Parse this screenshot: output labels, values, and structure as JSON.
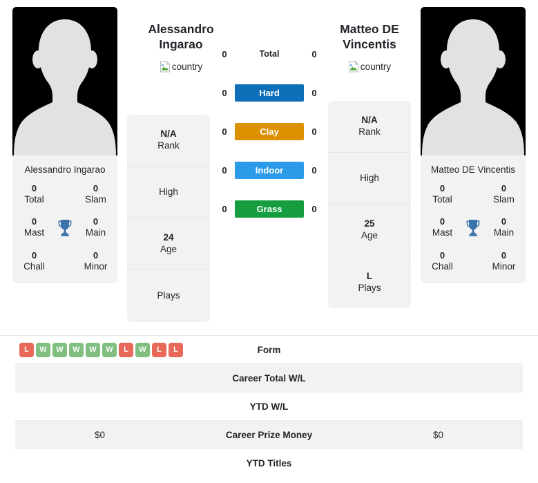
{
  "players": {
    "left": {
      "name": "Alessandro Ingarao",
      "display_name_line1": "Alessandro",
      "display_name_line2": "Ingarao",
      "country_alt": "country",
      "avatar_name": "player-avatar-placeholder",
      "titles": {
        "total_value": "0",
        "total_label": "Total",
        "slam_value": "0",
        "slam_label": "Slam",
        "mast_value": "0",
        "mast_label": "Mast",
        "main_value": "0",
        "main_label": "Main",
        "chall_value": "0",
        "chall_label": "Chall",
        "minor_value": "0",
        "minor_label": "Minor"
      },
      "info": {
        "rank_value": "N/A",
        "rank_label": "Rank",
        "high_value": "",
        "high_label": "High",
        "age_value": "24",
        "age_label": "Age",
        "plays_value": "",
        "plays_label": "Plays"
      },
      "surface_values": {
        "total": "0",
        "hard": "0",
        "clay": "0",
        "indoor": "0",
        "grass": "0"
      },
      "table_values": {
        "form": [
          "L",
          "W",
          "W",
          "W",
          "W",
          "W",
          "L",
          "W",
          "L",
          "L"
        ],
        "career_total_wl": "",
        "ytd_wl": "",
        "career_prize_money": "$0",
        "ytd_titles": ""
      }
    },
    "right": {
      "name": "Matteo DE Vincentis",
      "display_name_line1": "Matteo DE",
      "display_name_line2": "Vincentis",
      "country_alt": "country",
      "avatar_name": "player-avatar-placeholder",
      "titles": {
        "total_value": "0",
        "total_label": "Total",
        "slam_value": "0",
        "slam_label": "Slam",
        "mast_value": "0",
        "mast_label": "Mast",
        "main_value": "0",
        "main_label": "Main",
        "chall_value": "0",
        "chall_label": "Chall",
        "minor_value": "0",
        "minor_label": "Minor"
      },
      "info": {
        "rank_value": "N/A",
        "rank_label": "Rank",
        "high_value": "",
        "high_label": "High",
        "age_value": "25",
        "age_label": "Age",
        "plays_value": "L",
        "plays_label": "Plays"
      },
      "surface_values": {
        "total": "0",
        "hard": "0",
        "clay": "0",
        "indoor": "0",
        "grass": "0"
      },
      "table_values": {
        "career_total_wl": "",
        "ytd_wl": "",
        "career_prize_money": "$0",
        "ytd_titles": ""
      }
    }
  },
  "surfaces": [
    {
      "key": "total",
      "label": "Total",
      "color": "transparent",
      "text_color": "#212529"
    },
    {
      "key": "hard",
      "label": "Hard",
      "color": "#0e6eb8",
      "text_color": "#ffffff"
    },
    {
      "key": "clay",
      "label": "Clay",
      "color": "#dd9000",
      "text_color": "#ffffff"
    },
    {
      "key": "indoor",
      "label": "Indoor",
      "color": "#2b9ae8",
      "text_color": "#ffffff"
    },
    {
      "key": "grass",
      "label": "Grass",
      "color": "#169d40",
      "text_color": "#ffffff"
    }
  ],
  "stat_table": {
    "rows": [
      {
        "label": "Form",
        "type": "form"
      },
      {
        "label": "Career Total W/L",
        "type": "text"
      },
      {
        "label": "YTD W/L",
        "type": "text"
      },
      {
        "label": "Career Prize Money",
        "type": "text"
      },
      {
        "label": "YTD Titles",
        "type": "text"
      }
    ]
  },
  "colors": {
    "hard": "#0e6eb8",
    "clay": "#dd9000",
    "indoor": "#2b9ae8",
    "grass": "#169d40",
    "win": "#80bf80",
    "loss": "#e8685a",
    "trophy": "#3c72ab",
    "panel_bg": "#f2f2f2"
  }
}
